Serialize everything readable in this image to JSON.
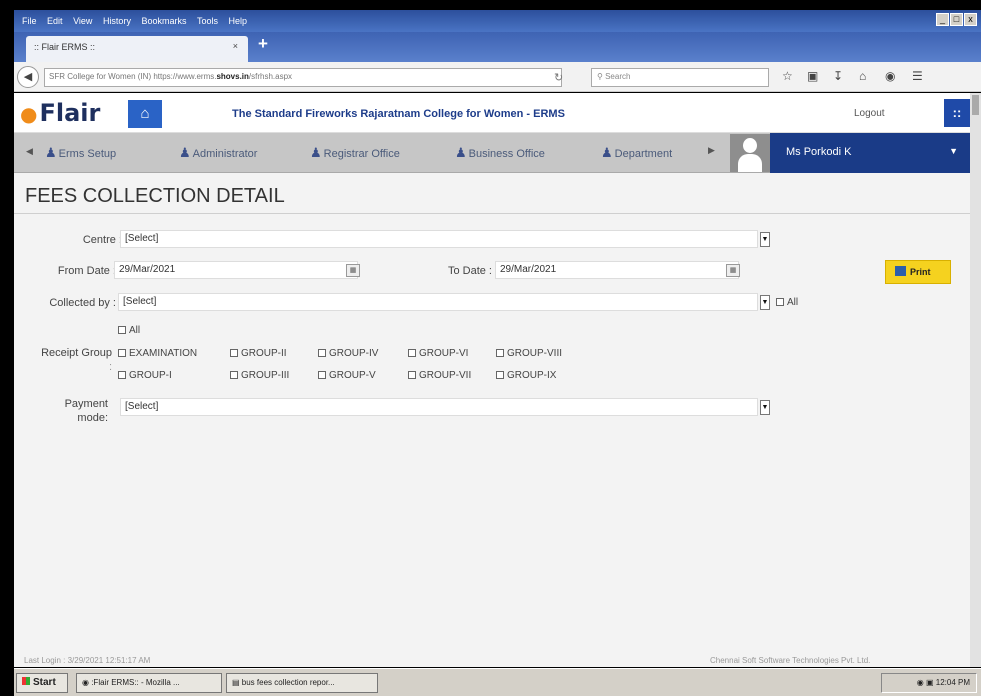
{
  "browser": {
    "menu": [
      "File",
      "Edit",
      "View",
      "History",
      "Bookmarks",
      "Tools",
      "Help"
    ],
    "window_controls": [
      "_",
      "□",
      "x"
    ],
    "tab_title": ":: Flair ERMS ::",
    "url_prefix": "SFR College for Women (IN)  https://www.erms.",
    "url_domain": "shovs.in",
    "url_suffix": "/sfrhsh.aspx",
    "search_placeholder": "Search"
  },
  "header": {
    "logo_text": "Flair",
    "college_name": "The Standard Fireworks Rajaratnam College for Women - ERMS",
    "logout": "Logout",
    "apps_glyph": "::"
  },
  "nav": {
    "modules": [
      "Erms Setup",
      "Administrator",
      "Registrar Office",
      "Business Office",
      "Department"
    ],
    "user": "Ms Porkodi K"
  },
  "page_title": "FEES COLLECTION DETAIL",
  "form": {
    "centre_label": "Centre :",
    "centre_value": "[Select]",
    "from_date_label": "From Date :",
    "from_date_value": "29/Mar/2021",
    "to_date_label": "To Date :",
    "to_date_value": "29/Mar/2021",
    "collected_by_label": "Collected by :",
    "collected_by_value": "[Select]",
    "collected_all": "All",
    "receipt_group_label": "Receipt Group",
    "receipt_group_colon": ":",
    "receipt_all": "All",
    "groups_row1": [
      "EXAMINATION",
      "GROUP-II",
      "GROUP-IV",
      "GROUP-VI",
      "GROUP-VIII"
    ],
    "groups_row2": [
      "GROUP-I",
      "GROUP-III",
      "GROUP-V",
      "GROUP-VII",
      "GROUP-IX"
    ],
    "payment_mode_label_1": "Payment",
    "payment_mode_label_2": "mode:",
    "payment_mode_value": "[Select]",
    "print": "Print"
  },
  "footer": {
    "last_login": "Last Login : 3/29/2021 12:51:17 AM",
    "copyright": "Chennai Soft Software Technologies Pvt. Ltd."
  },
  "taskbar": {
    "start": "Start",
    "task1": ":Flair ERMS:: - Mozilla ...",
    "task2": "bus fees collection repor...",
    "clock": "12:04 PM"
  }
}
